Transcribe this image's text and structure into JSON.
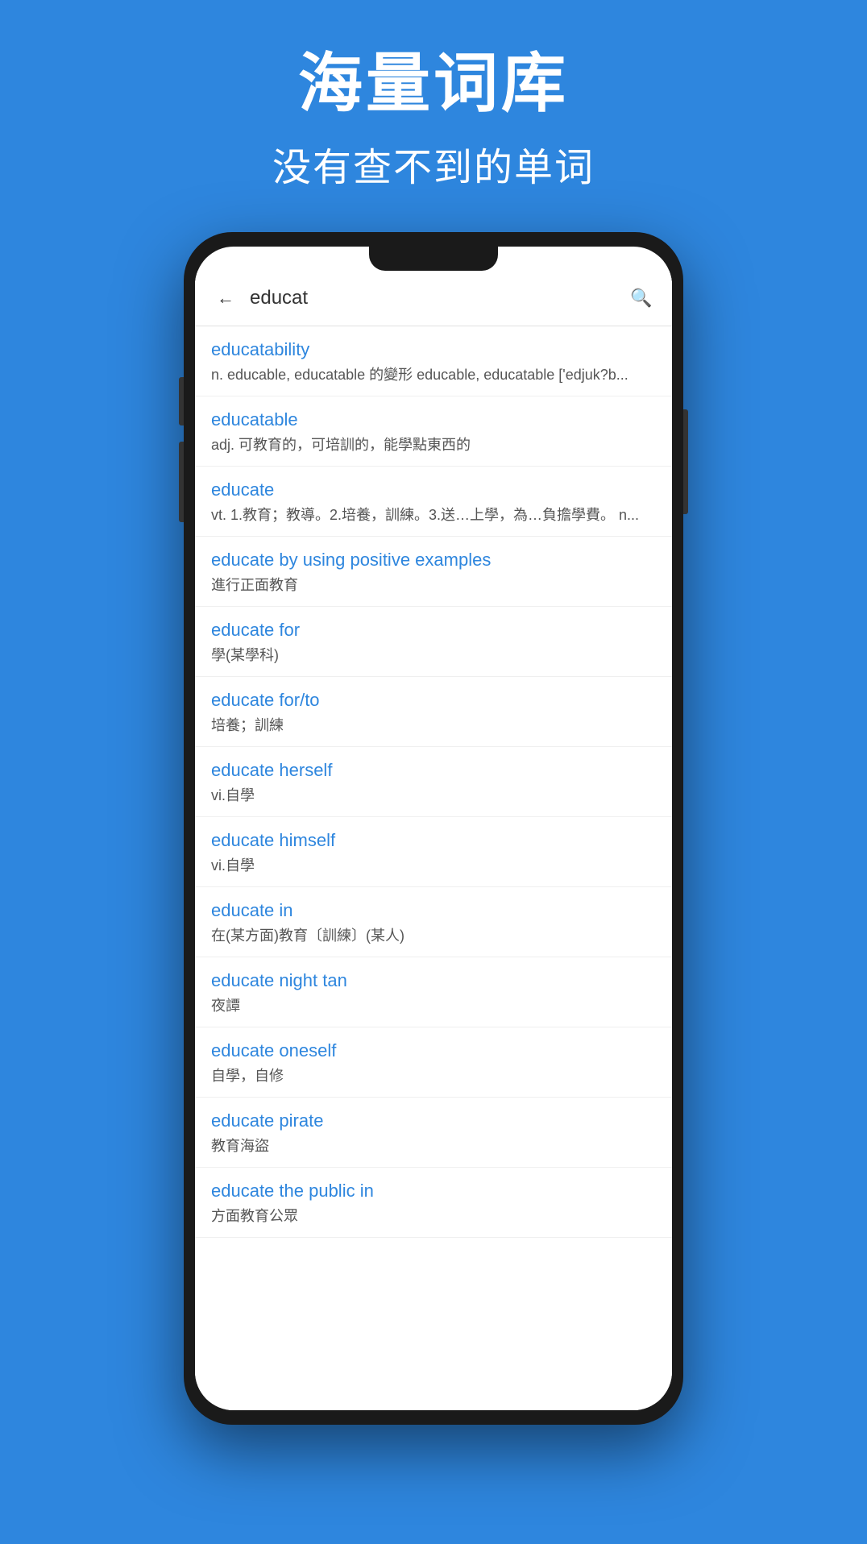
{
  "header": {
    "title": "海量词库",
    "subtitle": "没有查不到的单词"
  },
  "search": {
    "query": "educat",
    "placeholder": "educat"
  },
  "results": [
    {
      "term": "educatability",
      "desc": "n.    educable, educatable 的變形    educable, educatable    ['edjuk?b..."
    },
    {
      "term": "educatable",
      "desc": "adj. 可教育的，可培訓的，能學點東西的"
    },
    {
      "term": "educate",
      "desc": "vt.  1.教育；教導。2.培養，訓練。3.送…上學，為…負擔學費。  n..."
    },
    {
      "term": "educate by using positive examples",
      "desc": "進行正面教育"
    },
    {
      "term": "educate for",
      "desc": "學(某學科)"
    },
    {
      "term": "educate for/to",
      "desc": "培養；訓練"
    },
    {
      "term": "educate herself",
      "desc": "vi.自學"
    },
    {
      "term": "educate himself",
      "desc": "vi.自學"
    },
    {
      "term": "educate in",
      "desc": "在(某方面)教育〔訓練〕(某人)"
    },
    {
      "term": "educate night tan",
      "desc": "夜譚"
    },
    {
      "term": "educate oneself",
      "desc": "自學，自修"
    },
    {
      "term": "educate pirate",
      "desc": "教育海盜"
    },
    {
      "term": "educate the public in",
      "desc": "方面教育公眾"
    }
  ]
}
